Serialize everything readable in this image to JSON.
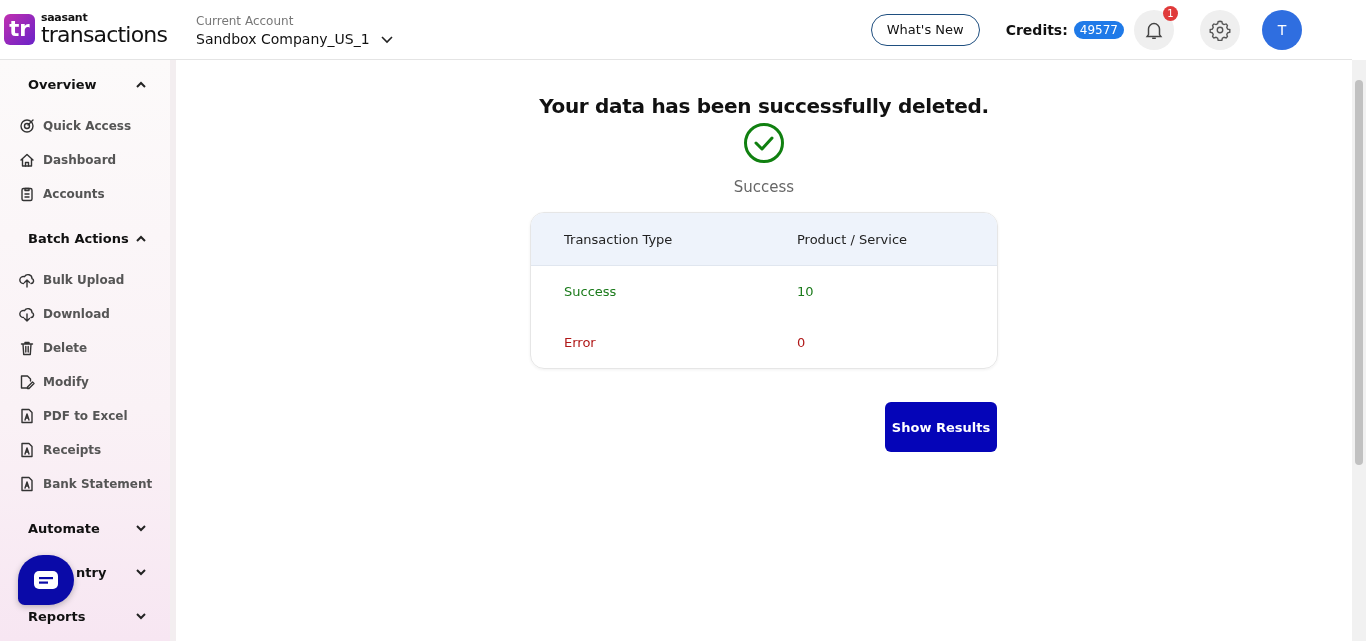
{
  "header": {
    "logo_mark": "tr",
    "logo_top": "saasant",
    "logo_bottom": "transactions",
    "account_label": "Current Account",
    "account_name": "Sandbox Company_US_1",
    "whats_new": "What's New",
    "credits_label": "Credits:",
    "credits_value": "49577",
    "notification_count": "1",
    "avatar": "T"
  },
  "sidebar": {
    "sections": [
      {
        "title": "Overview",
        "expanded": true,
        "kind": "normal",
        "items": [
          {
            "label": "Quick Access",
            "kind": "target"
          },
          {
            "label": "Dashboard",
            "kind": "home"
          },
          {
            "label": "Accounts",
            "kind": "clipboard"
          }
        ]
      },
      {
        "title": "Batch Actions",
        "expanded": true,
        "kind": "normal",
        "items": [
          {
            "label": "Bulk Upload",
            "kind": "upload"
          },
          {
            "label": "Download",
            "kind": "download"
          },
          {
            "label": "Delete",
            "kind": "trash"
          },
          {
            "label": "Modify",
            "kind": "edit"
          },
          {
            "label": "PDF to Excel",
            "kind": "pdf"
          },
          {
            "label": "Receipts",
            "kind": "pdf"
          },
          {
            "label": "Bank Statement",
            "kind": "pdf"
          }
        ]
      },
      {
        "title": "Automate",
        "expanded": false,
        "kind": "normal"
      },
      {
        "title": "ntry",
        "expanded": false,
        "kind": "covered"
      },
      {
        "title": "Reports",
        "expanded": false,
        "kind": "normal"
      }
    ]
  },
  "result": {
    "heading": "Your data has been successfully deleted.",
    "status": "Success",
    "table": {
      "columns": [
        "Transaction Type",
        "Product / Service"
      ],
      "rows": [
        {
          "kind": "success",
          "cells": [
            "Success",
            "10"
          ]
        },
        {
          "kind": "error",
          "cells": [
            "Error",
            "0"
          ]
        }
      ]
    },
    "button": "Show Results"
  }
}
